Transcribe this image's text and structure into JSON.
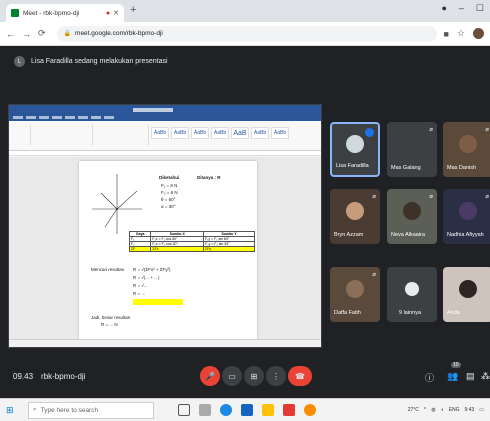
{
  "browser": {
    "tab_title": "Meet - rbk-bpmo-dji",
    "new_tab_glyph": "+",
    "url": "meet.google.com/rbk-bpmo-dji"
  },
  "meet": {
    "presenting_text": "Lisa Faradilla sedang melakukan presentasi",
    "time": "09.43",
    "meeting_code": "rbk-bpmo-dji",
    "participant_count": "10",
    "participants": [
      {
        "name": "Lisa Faradilla"
      },
      {
        "name": "Mas Galang"
      },
      {
        "name": "Mas Danish"
      },
      {
        "name": "Bryn Azzam"
      },
      {
        "name": "Neva Alkaaira"
      },
      {
        "name": "Nadhia Afiyyah"
      },
      {
        "name": "Daffa Fatih"
      },
      {
        "name": "9 lainnya"
      },
      {
        "name": "Anda"
      }
    ]
  },
  "document": {
    "heading_left": "Diketahui",
    "heading_right": "Ditanya : R",
    "given": [
      "F₁ = 8 N",
      "F₂ = 6 N",
      "θ = 60°",
      "α = 30°"
    ],
    "table_header": [
      "Gaya",
      "Sumbu X",
      "Sumbu Y"
    ],
    "table_rows": [
      [
        "F₁",
        "F₁x = F₁ cos 60°",
        "F₁y = F₁ sin 60°"
      ],
      [
        "F₂",
        "F₂x = F₂ cos 30°",
        "F₂y = F₂ sin 30°"
      ],
      [
        "ΣF",
        "ΣFx",
        "ΣFy"
      ]
    ],
    "formula_label": "Mencari resultan",
    "formulas": [
      "R = √(ΣFx² + ΣFy²)",
      "R = √(... + ...)",
      "R = √...",
      "R = ..."
    ],
    "note_bottom": [
      "Jadi, besar resultan",
      "R = ... N"
    ]
  },
  "taskbar": {
    "search_placeholder": "Type here to search",
    "temperature": "27°C",
    "language": "ENG",
    "clock": "9:43"
  },
  "colors": {
    "meet_bg": "#202124",
    "tile_bg": "#3c4043",
    "end_call": "#ea4335",
    "word_blue": "#2b579a",
    "highlight": "#ffff00"
  }
}
